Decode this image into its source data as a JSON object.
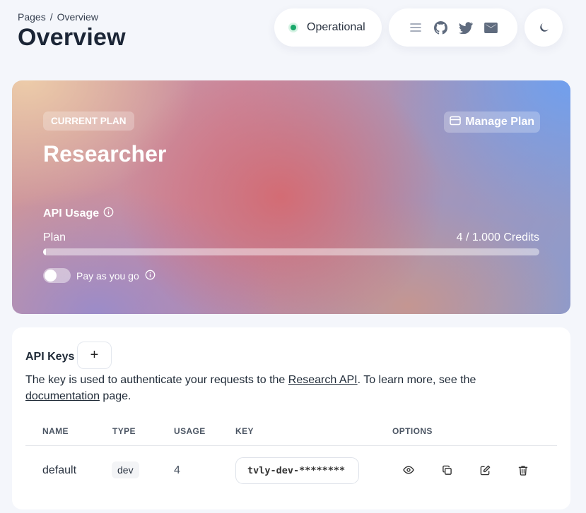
{
  "breadcrumb": {
    "root": "Pages",
    "separator": "/",
    "current": "Overview"
  },
  "header": {
    "title": "Overview"
  },
  "status": {
    "text": "Operational",
    "color": "#19a86a"
  },
  "header_icons": [
    "menu-icon",
    "github-icon",
    "twitter-icon",
    "mail-icon",
    "moon-icon"
  ],
  "plan": {
    "badge": "CURRENT PLAN",
    "manage_label": "Manage Plan",
    "name": "Researcher",
    "usage_label": "API Usage",
    "row_label": "Plan",
    "credits": "4 / 1.000 Credits",
    "progress_fraction": 0.004,
    "payg_label": "Pay as you go",
    "payg_enabled": false
  },
  "api_keys": {
    "title": "API Keys",
    "add_label": "+",
    "description_pre": "The key is used to authenticate your requests to the ",
    "description_link1": "Research API",
    "description_mid": ". To learn more, see the ",
    "description_link2": "documentation",
    "description_post": " page.",
    "columns": [
      "NAME",
      "TYPE",
      "USAGE",
      "KEY",
      "OPTIONS"
    ],
    "rows": [
      {
        "name": "default",
        "type": "dev",
        "usage": "4",
        "key": "tvly-dev-********"
      }
    ]
  }
}
